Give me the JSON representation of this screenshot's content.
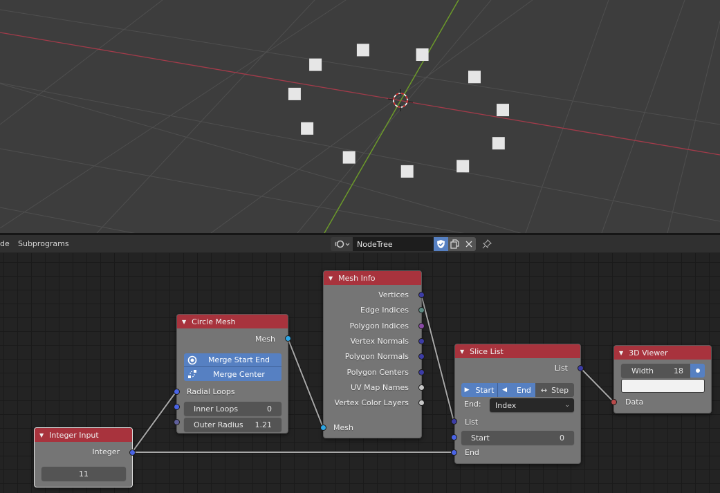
{
  "viewport": {
    "points": 11,
    "colors": {
      "background": "#3d3d3d",
      "grid": "#4f4f4f",
      "x_axis": "#a33b4a",
      "y_axis": "#6c9a2a",
      "point": "#e6e6e6"
    }
  },
  "header": {
    "menu": [
      "de",
      "Subprograms"
    ],
    "editor_type_icon": "node-tree-icon",
    "tree_name": "NodeTree",
    "fake_user_icon": "shield-check-icon",
    "duplicate_icon": "duplicate-icon",
    "unlink_icon": "close-icon",
    "pin_icon": "pin-icon"
  },
  "nodes": {
    "integer_input": {
      "title": "Integer Input",
      "output": "Integer",
      "value": "11"
    },
    "circle_mesh": {
      "title": "Circle Mesh",
      "output": "Mesh",
      "toggles": [
        {
          "label": "Merge Start End",
          "icon": "merge-start-end-icon",
          "active": true
        },
        {
          "label": "Merge Center",
          "icon": "merge-center-icon",
          "active": true
        }
      ],
      "inputs": {
        "radial_loops": "Radial Loops",
        "inner_loops_label": "Inner Loops",
        "inner_loops_value": "0",
        "outer_radius_label": "Outer Radius",
        "outer_radius_value": "1.21"
      }
    },
    "mesh_info": {
      "title": "Mesh Info",
      "outputs": [
        "Vertices",
        "Edge Indices",
        "Polygon Indices",
        "Vertex Normals",
        "Polygon Normals",
        "Polygon Centers",
        "UV Map Names",
        "Vertex Color Layers"
      ],
      "input": "Mesh"
    },
    "slice_list": {
      "title": "Slice List",
      "output": "List",
      "modes": [
        {
          "label": "Start",
          "icon": "play-right-icon",
          "active": true
        },
        {
          "label": "End",
          "icon": "play-left-icon",
          "active": true
        },
        {
          "label": "Step",
          "icon": "arrows-horizontal-icon",
          "active": false
        }
      ],
      "end_label": "End:",
      "end_mode": "Index",
      "inputs": {
        "list": "List",
        "start_label": "Start",
        "start_value": "0",
        "end": "End"
      }
    },
    "viewer_3d": {
      "title": "3D Viewer",
      "width_label": "Width",
      "width_value": "18",
      "input": "Data"
    }
  },
  "colors": {
    "node_header": "#a8333d",
    "node_body": "#757575",
    "toggle_active": "#5680c2",
    "socket_integer": "#4a64e6",
    "socket_mesh": "#2ea7e6",
    "socket_vector": "#3c3ca6",
    "socket_edge": "#5d8a83",
    "socket_polygon": "#8a4aa6",
    "socket_generic": "#c8c8c8",
    "socket_float": "#5f5f9c",
    "socket_data": "#b84a4a"
  }
}
